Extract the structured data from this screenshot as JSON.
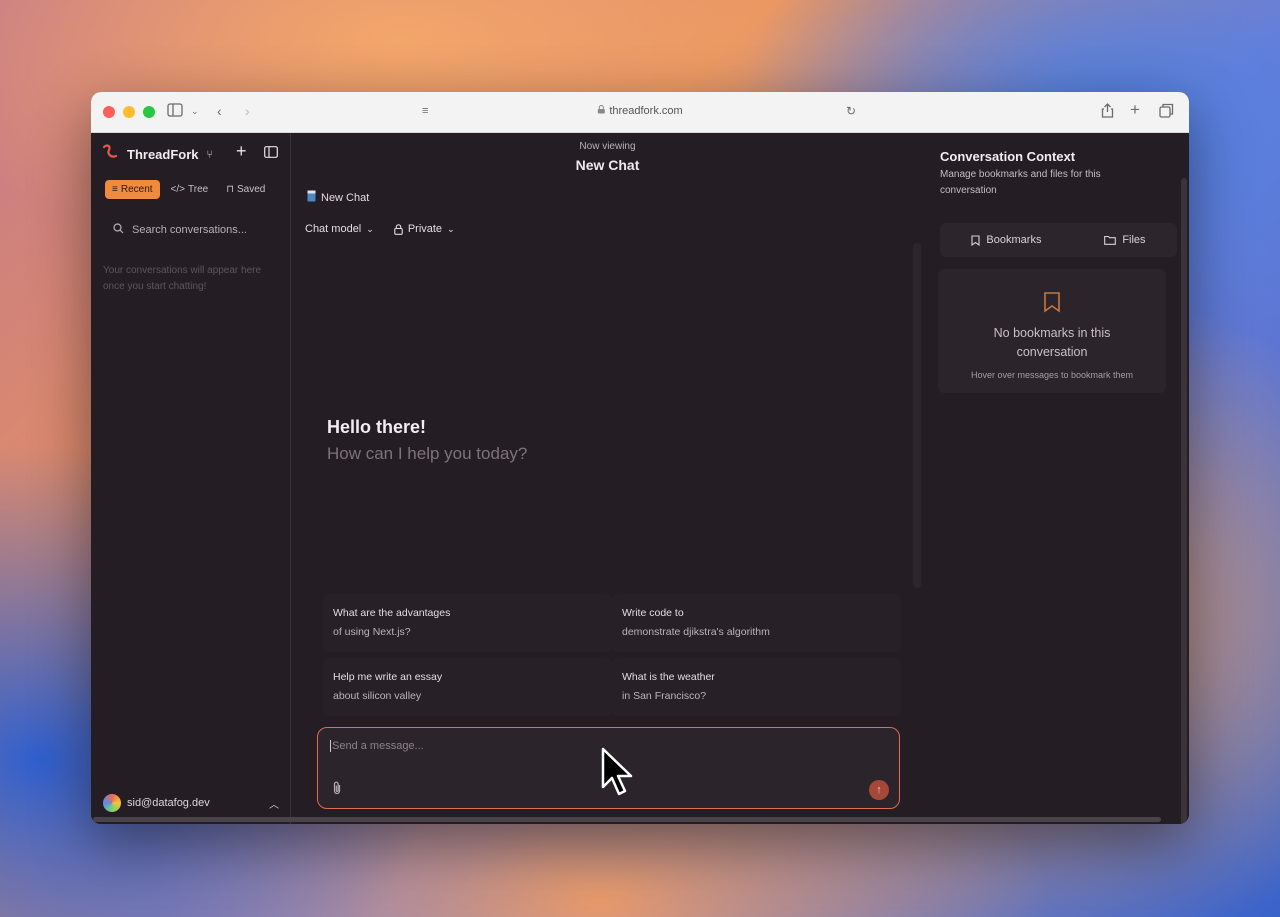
{
  "browser": {
    "url": "threadfork.com",
    "traffic_colors": [
      "#ff5f57",
      "#febc2e",
      "#28c840"
    ]
  },
  "sidebar": {
    "app_name": "ThreadFork",
    "tabs": [
      {
        "label": "Recent",
        "icon": "list-icon",
        "active": true
      },
      {
        "label": "Tree",
        "icon": "code-icon",
        "active": false
      },
      {
        "label": "Saved",
        "icon": "bookmark-icon",
        "active": false
      }
    ],
    "search_placeholder": "Search conversations...",
    "empty_text": "Your conversations will appear here once you start chatting!",
    "user_email": "sid@datafog.dev"
  },
  "main": {
    "now_viewing_label": "Now viewing",
    "title": "New Chat",
    "chat_chip": "New Chat",
    "model_selector": "Chat model",
    "visibility_selector": "Private",
    "greeting": "Hello there!",
    "subgreeting": "How can I help you today?",
    "suggestions": [
      {
        "line1": "What are the advantages",
        "line2": "of using Next.js?"
      },
      {
        "line1": "Write code to",
        "line2": "demonstrate djikstra's algorithm"
      },
      {
        "line1": "Help me write an essay",
        "line2": "about silicon valley"
      },
      {
        "line1": "What is the weather",
        "line2": "in San Francisco?"
      }
    ],
    "composer_placeholder": "Send a message..."
  },
  "panel": {
    "title": "Conversation Context",
    "subtitle": "Manage bookmarks and files for this conversation",
    "tabs": [
      {
        "label": "Bookmarks",
        "icon": "bookmark-icon"
      },
      {
        "label": "Files",
        "icon": "folder-icon"
      }
    ],
    "empty_title": "No bookmarks in this conversation",
    "empty_hint": "Hover over messages to bookmark them"
  },
  "colors": {
    "accent": "#f08a3c",
    "composer_border": "#e06a55",
    "background": "#241d24"
  }
}
